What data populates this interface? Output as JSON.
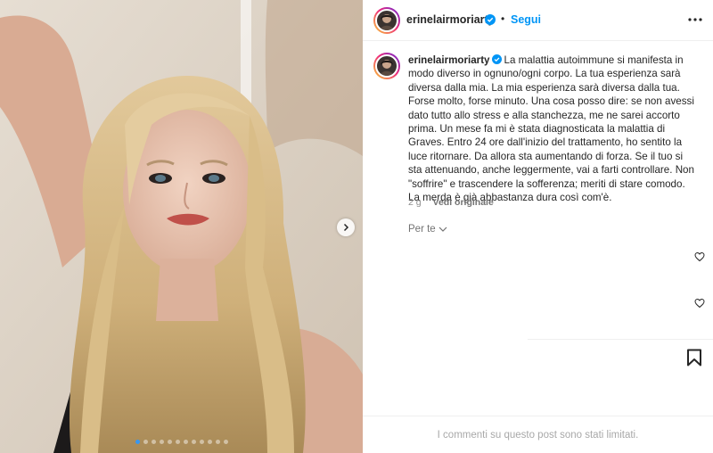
{
  "post": {
    "username": "erinelairmoriarty",
    "separator": "•",
    "follow_label": "Segui",
    "carousel": {
      "slide_count": 12,
      "active_index": 0
    }
  },
  "caption": {
    "username": "erinelairmoriarty",
    "text": "La malattia autoimmune si manifesta in modo diverso in ognuno/ogni corpo. La tua esperienza sarà diversa dalla mia. La mia esperienza sarà diversa dalla tua. Forse molto, forse minuto. Una cosa posso dire: se non avessi dato tutto allo stress e alla stanchezza, me ne sarei accorto prima. Un mese fa mi è stata diagnosticata la malattia di Graves. Entro 24 ore dall'inizio del trattamento, ho sentito la luce ritornare. Da allora sta aumentando di forza. Se il tuo si sta attenuando, anche leggermente, vai a farti controllare. Non \"soffrire\" e trascendere la sofferenza; meriti di stare comodo. La merda è già abbastanza dura così com'è.",
    "time_ago": "2 g",
    "see_original": "Vedi originale"
  },
  "comments": {
    "per_te_label": "Per te",
    "limited_message": "I commenti su questo post sono stati limitati."
  },
  "icons": {
    "verified": "verified-badge-icon",
    "more": "more-horizontal-icon",
    "next": "chevron-right-icon",
    "heart": "heart-outline-icon",
    "bookmark": "bookmark-icon",
    "chevron": "chevron-down-icon"
  },
  "colors": {
    "link_blue": "#0095f6",
    "verified_blue": "#0095f6",
    "muted": "#8e8e8e"
  }
}
